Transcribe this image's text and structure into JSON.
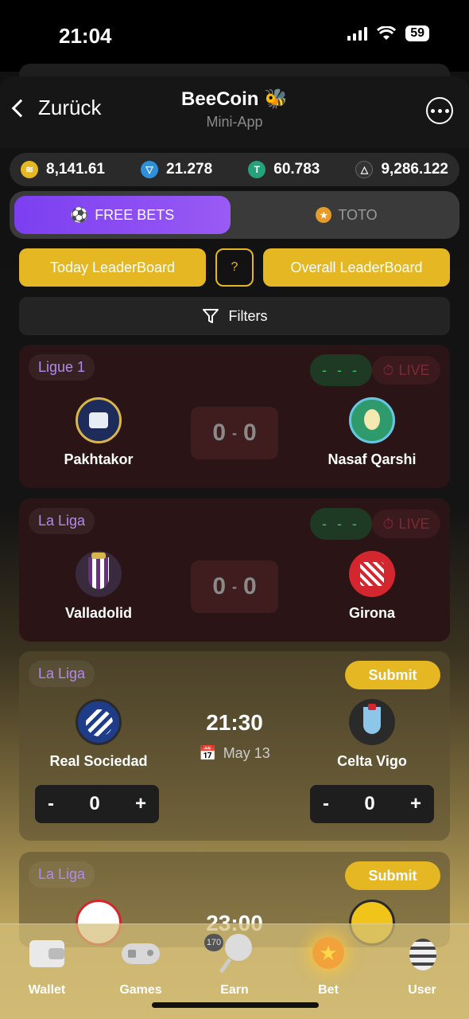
{
  "status_bar": {
    "time": "21:04",
    "battery": "59"
  },
  "header": {
    "back_label": "Zurück",
    "title": "BeeCoin 🐝",
    "subtitle": "Mini-App"
  },
  "balances": [
    {
      "icon": "gold-coin-icon",
      "value": "8,141.61",
      "color": "#e5b723"
    },
    {
      "icon": "ton-icon",
      "value": "21.278",
      "color": "#2f8fd8"
    },
    {
      "icon": "tether-icon",
      "value": "60.783",
      "color": "#26a17b"
    },
    {
      "icon": "triangle-token-icon",
      "value": "9,286.122",
      "color": "#333333"
    }
  ],
  "segments": {
    "active": "FREE BETS",
    "inactive": "TOTO"
  },
  "leaderboards": {
    "today": "Today LeaderBoard",
    "help": "?",
    "overall": "Overall LeaderBoard"
  },
  "filters_label": "Filters",
  "live_matches": [
    {
      "league": "Ligue 1",
      "status": "- - -",
      "live": "LIVE",
      "home": "Pakhtakor",
      "away": "Nasaf Qarshi",
      "home_score": "0",
      "away_score": "0"
    },
    {
      "league": "La Liga",
      "status": "- - -",
      "live": "LIVE",
      "home": "Valladolid",
      "away": "Girona",
      "home_score": "0",
      "away_score": "0"
    }
  ],
  "upcoming_matches": [
    {
      "league": "La Liga",
      "submit": "Submit",
      "home": "Real Sociedad",
      "away": "Celta Vigo",
      "time": "21:30",
      "date": "May 13",
      "home_pick": "0",
      "away_pick": "0",
      "minus": "-",
      "plus": "+"
    },
    {
      "league": "La Liga",
      "submit": "Submit",
      "time": "23:00"
    }
  ],
  "tabbar": [
    {
      "label": "Wallet",
      "icon": "wallet-icon"
    },
    {
      "label": "Games",
      "icon": "gamepad-icon"
    },
    {
      "label": "Earn",
      "icon": "lollipop-icon",
      "badge": "170"
    },
    {
      "label": "Bet",
      "icon": "star-icon"
    },
    {
      "label": "User",
      "icon": "bee-icon"
    }
  ],
  "colors": {
    "accent_gold": "#e5b723",
    "accent_purple": "#8a4cf2",
    "live_red": "#7a2a33",
    "status_green": "#39c15a"
  }
}
